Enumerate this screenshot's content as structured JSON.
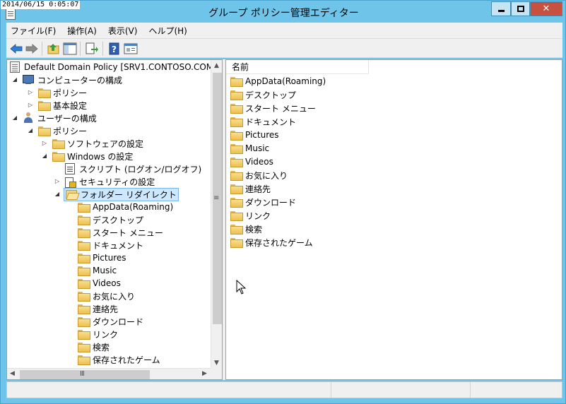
{
  "timestamp": "2014/06/15 0:05:07",
  "window": {
    "title": "グループ ポリシー管理エディター"
  },
  "menu": [
    "ファイル(F)",
    "操作(A)",
    "表示(V)",
    "ヘルプ(H)"
  ],
  "tree": {
    "root": "Default Domain Policy [SRV1.CONTOSO.COM",
    "computer_config": "コンピューターの構成",
    "computer_policy": "ポリシー",
    "computer_prefs": "基本設定",
    "user_config": "ユーザーの構成",
    "user_policy": "ポリシー",
    "software_settings": "ソフトウェアの設定",
    "windows_settings": "Windows の設定",
    "scripts": "スクリプト (ログオン/ログオフ)",
    "security": "セキュリティの設定",
    "folder_redirection": "フォルダー リダイレクト",
    "redirect_items": [
      "AppData(Roaming)",
      "デスクトップ",
      "スタート メニュー",
      "ドキュメント",
      "Pictures",
      "Music",
      "Videos",
      "お気に入り",
      "連絡先",
      "ダウンロード",
      "リンク",
      "検索",
      "保存されたゲーム"
    ]
  },
  "list": {
    "column_name": "名前",
    "items": [
      "AppData(Roaming)",
      "デスクトップ",
      "スタート メニュー",
      "ドキュメント",
      "Pictures",
      "Music",
      "Videos",
      "お気に入り",
      "連絡先",
      "ダウンロード",
      "リンク",
      "検索",
      "保存されたゲーム"
    ]
  },
  "colors": {
    "title_bg": "#6fc4e9",
    "close_button": "#c7503f",
    "selection": "#cce8ff"
  }
}
